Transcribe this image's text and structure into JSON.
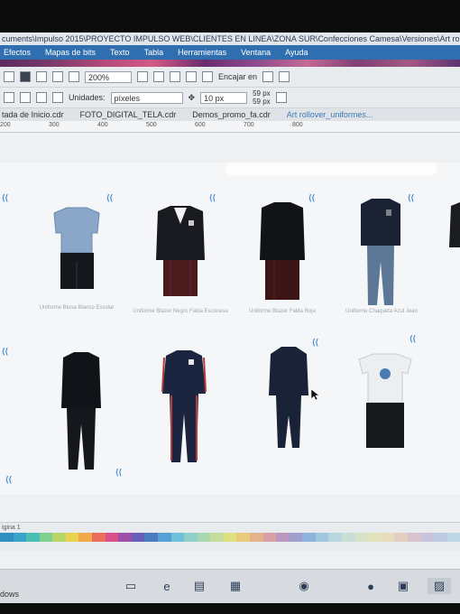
{
  "window": {
    "title_path": "cuments\\Impulso 2015\\PROYECTO IMPULSO WEB\\CLIENTES EN LINEA\\ZONA SUR\\Confecciones Camesa\\Versiones\\Art rol..."
  },
  "menu": [
    "Efectos",
    "Mapas de bits",
    "Texto",
    "Tabla",
    "Herramientas",
    "Ventana",
    "Ayuda"
  ],
  "toolbar1": {
    "zoom": "200%",
    "snap_label": "Encajar en"
  },
  "toolbar2": {
    "units_label": "Unidades:",
    "units_value": "píxeles",
    "nudge_value": "10 px",
    "dup_x": "59 px",
    "dup_y": "59 px"
  },
  "document_tabs": [
    "tada de Inicio.cdr",
    "FOTO_DIGITAL_TELA.cdr",
    "Demos_promo_fa.cdr",
    "Art rollover_uniformes..."
  ],
  "ruler": {
    "marks": [
      "200",
      "300",
      "400",
      "500",
      "600",
      "700",
      "800"
    ]
  },
  "items": [
    {
      "name": "blue-polo-black-shorts",
      "caption": "Uniforme Blusa Blanco Escolar"
    },
    {
      "name": "black-blazer-red-skirt",
      "caption": "Uniforme Blazer Negro Falda Escocesa"
    },
    {
      "name": "black-coat-red-skirt",
      "caption": "Uniforme Blazer Falda Roja"
    },
    {
      "name": "navy-jacket-jeans",
      "caption": "Uniforme Chaqueta Azul Jean"
    },
    {
      "name": "black-tracksuit",
      "caption": ""
    },
    {
      "name": "navy-red-tracksuit",
      "caption": ""
    },
    {
      "name": "navy-hoodie-tracksuit",
      "caption": ""
    },
    {
      "name": "white-tshirt-black-shorts",
      "caption": ""
    }
  ],
  "statusbar": {
    "page": "igina 1"
  },
  "palette_colors": [
    "#2f8fbf",
    "#39a3c9",
    "#4cbfb5",
    "#7fcf8f",
    "#b6d66b",
    "#e8d24f",
    "#f0a84a",
    "#e86f5a",
    "#d9508a",
    "#9e4fa8",
    "#6a5fb8",
    "#4d7bc2",
    "#56a0d6",
    "#6fc0d9",
    "#8fd0c9",
    "#a8d8b0",
    "#c6dc9c",
    "#dfe07e",
    "#e8cc7d",
    "#e5b38b",
    "#d89fa4",
    "#bb98bf",
    "#9f9fce",
    "#8fb3db",
    "#9fc8df",
    "#b7d7de",
    "#c9dfd6",
    "#d7e3c9",
    "#e2e3bb",
    "#e6dcbc",
    "#e3cfc2",
    "#d8c4cf",
    "#c9c4db",
    "#bccbe2",
    "#bfd6e4"
  ],
  "taskbar": {
    "label": "dows",
    "icons": [
      "task-view-icon",
      "edge-icon",
      "file-explorer-icon",
      "store-icon",
      "coreldraw-icon",
      "chrome-icon",
      "app-icon",
      "active-window-icon"
    ]
  }
}
